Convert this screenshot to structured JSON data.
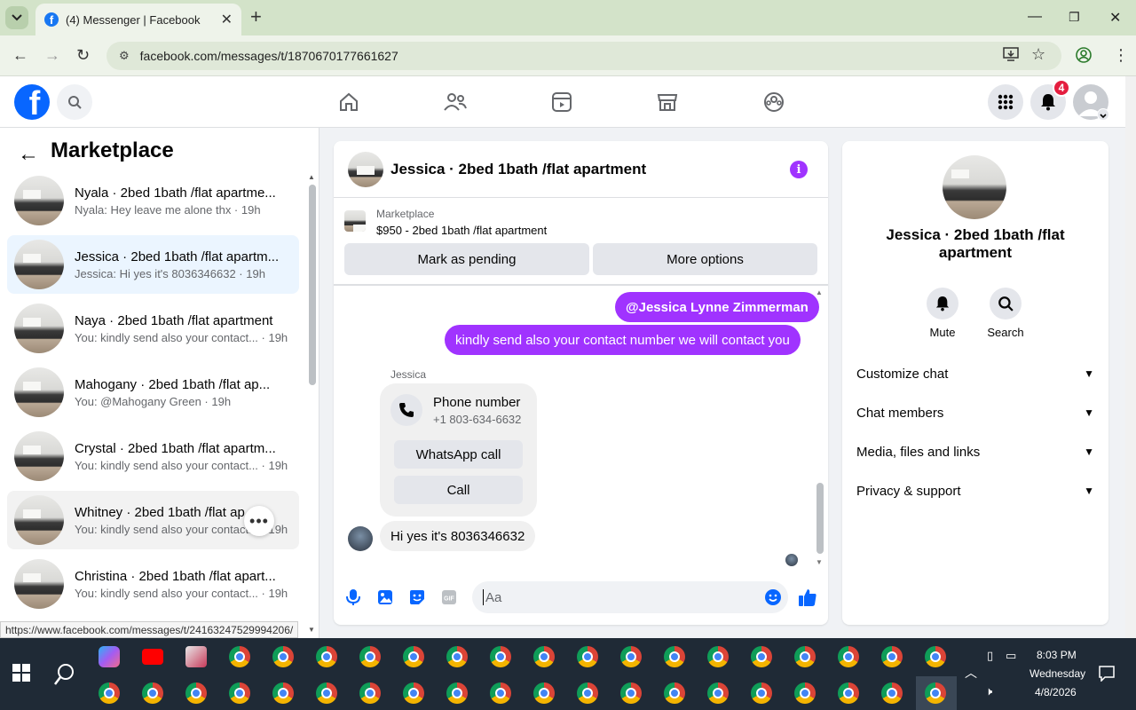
{
  "browser": {
    "tab_title": "(4) Messenger | Facebook",
    "url": "facebook.com/messages/t/1870670177661627",
    "status_url": "https://www.facebook.com/messages/t/24163247529994206/"
  },
  "header": {
    "notification_count": "4",
    "logo_letter": "f"
  },
  "left_panel": {
    "back_arrow": "←",
    "title": "Marketplace",
    "conversations": [
      {
        "name": "Nyala · 2bed 1bath /flat apartme...",
        "preview": "Nyala: Hey leave me alone thx · 19h"
      },
      {
        "name": "Jessica · 2bed 1bath /flat apartm...",
        "preview": "Jessica: Hi yes it's 8036346632 · 19h"
      },
      {
        "name": "Naya · 2bed 1bath /flat apartment",
        "preview": "You: kindly send also your contact... · 19h"
      },
      {
        "name": "Mahogany · 2bed 1bath /flat ap...",
        "preview": "You: @Mahogany Green · 19h"
      },
      {
        "name": "Crystal · 2bed 1bath /flat apartm...",
        "preview": "You: kindly send also your contact... · 19h"
      },
      {
        "name": "Whitney · 2bed 1bath /flat ap...",
        "preview": "You: kindly send also your contact... · 19h"
      },
      {
        "name": "Christina · 2bed 1bath /flat apart...",
        "preview": "You: kindly send also your contact... · 19h"
      }
    ]
  },
  "chat": {
    "title": "Jessica · 2bed 1bath /flat apartment",
    "marketplace_label": "Marketplace",
    "listing": "$950 - 2bed 1bath /flat apartment",
    "mark_pending": "Mark as pending",
    "more_options": "More options",
    "outgoing": [
      "@Jessica Lynne Zimmerman",
      "kindly send also your contact number  we will contact you"
    ],
    "sender": "Jessica",
    "contact_card": {
      "title": "Phone number",
      "number": "+1 803-634-6632",
      "whatsapp": "WhatsApp call",
      "call": "Call"
    },
    "incoming": "Hi yes it's 8036346632",
    "composer_placeholder": "Aa"
  },
  "right_panel": {
    "name": "Jessica · 2bed 1bath /flat apartment",
    "mute": "Mute",
    "search": "Search",
    "sections": [
      "Customize chat",
      "Chat members",
      "Media, files and links",
      "Privacy & support"
    ]
  },
  "taskbar": {
    "time": "8:03 PM",
    "day": "Wednesday",
    "date": "4/8/2026"
  },
  "colors": {
    "accent": "#a033ff",
    "fb_blue": "#0866ff",
    "badge": "#e41e3f"
  }
}
